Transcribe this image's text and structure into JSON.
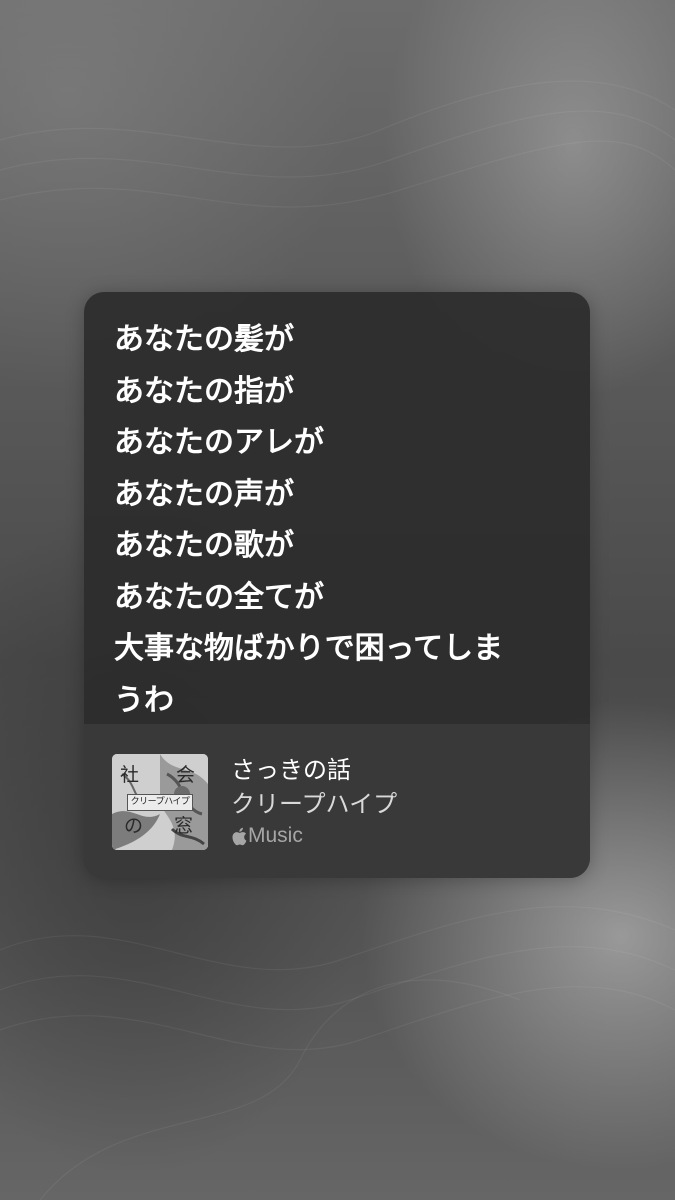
{
  "lyrics": {
    "lines": [
      "あなたの髪が",
      "あなたの指が",
      "あなたのアレが",
      "あなたの声が",
      "あなたの歌が",
      "あなたの全てが",
      "大事な物ばかりで困ってしま",
      "うわ"
    ]
  },
  "song": {
    "title": "さっきの話",
    "artist": "クリープハイプ",
    "service": {
      "icon": "apple-logo-icon",
      "label": "Music"
    }
  },
  "artwork": {
    "chars": [
      "社",
      "会",
      "の",
      "窓"
    ],
    "label": "クリープハイプ"
  },
  "colors": {
    "card": "#2c2c2c",
    "footer": "#3a3a3a",
    "lyric_text": "#ffffff",
    "service_text": "#a6a6a6"
  }
}
